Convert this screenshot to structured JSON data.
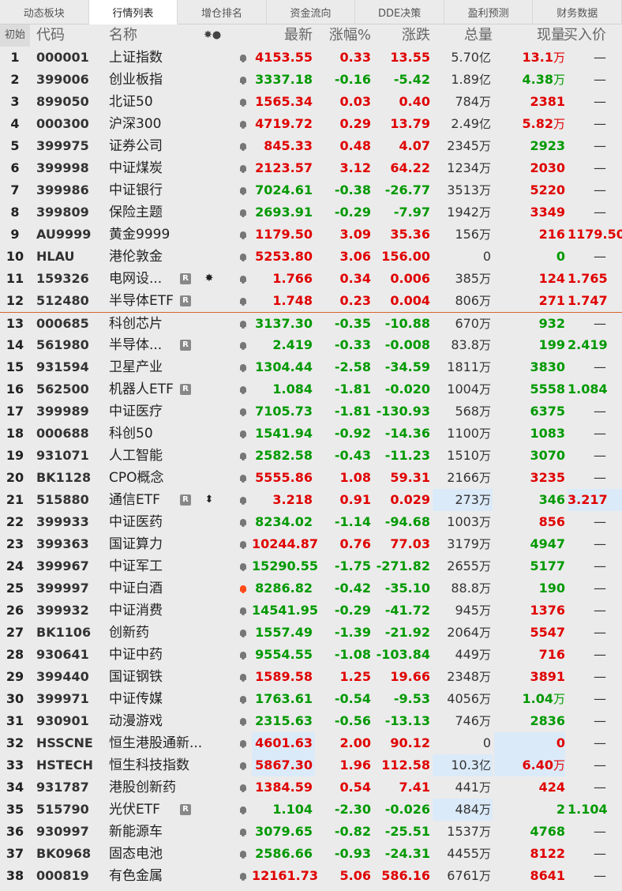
{
  "tabs": [
    "动态板块",
    "行情列表",
    "增仓排名",
    "资金流向",
    "DDE决策",
    "盈利预测",
    "财务数据"
  ],
  "active_tab": 1,
  "header": {
    "initial": "初始",
    "code": "代码",
    "name": "名称",
    "icons": "✸●",
    "last": "最新",
    "pct": "涨幅%",
    "change": "涨跌",
    "volume": "总量",
    "current": "现量",
    "bid": "买入价"
  },
  "colors": {
    "up": "#e00000",
    "down": "#009900",
    "highlight": "#dbeaf8",
    "separator": "#d9632c",
    "alert": "#ff4a1a"
  },
  "rows": [
    {
      "idx": "1",
      "code": "000001",
      "name": "上证指数",
      "badge": "",
      "star": "",
      "bell": "normal",
      "last": "4153.55",
      "pct": "0.33",
      "chg": "13.55",
      "vol": "5.70",
      "vol_unit": "亿",
      "cur": "13.1",
      "cur_unit": "万",
      "bid": "—",
      "dir": "up",
      "cur_color": "up",
      "bid_color": "dash"
    },
    {
      "idx": "2",
      "code": "399006",
      "name": "创业板指",
      "badge": "",
      "star": "",
      "bell": "normal",
      "last": "3337.18",
      "pct": "-0.16",
      "chg": "-5.42",
      "vol": "1.89",
      "vol_unit": "亿",
      "cur": "4.38",
      "cur_unit": "万",
      "bid": "—",
      "dir": "down",
      "cur_color": "down",
      "bid_color": "dash"
    },
    {
      "idx": "3",
      "code": "899050",
      "name": "北证50",
      "badge": "",
      "star": "",
      "bell": "normal",
      "last": "1565.34",
      "pct": "0.03",
      "chg": "0.40",
      "vol": "784",
      "vol_unit": "万",
      "cur": "2381",
      "cur_unit": "",
      "bid": "—",
      "dir": "up",
      "cur_color": "up",
      "bid_color": "dash"
    },
    {
      "idx": "4",
      "code": "000300",
      "name": "沪深300",
      "badge": "",
      "star": "",
      "bell": "normal",
      "last": "4719.72",
      "pct": "0.29",
      "chg": "13.79",
      "vol": "2.49",
      "vol_unit": "亿",
      "cur": "5.82",
      "cur_unit": "万",
      "bid": "—",
      "dir": "up",
      "cur_color": "up",
      "bid_color": "dash"
    },
    {
      "idx": "5",
      "code": "399975",
      "name": "证券公司",
      "badge": "",
      "star": "",
      "bell": "normal",
      "last": "845.33",
      "pct": "0.48",
      "chg": "4.07",
      "vol": "2345",
      "vol_unit": "万",
      "cur": "2923",
      "cur_unit": "",
      "bid": "—",
      "dir": "up",
      "cur_color": "down",
      "bid_color": "dash"
    },
    {
      "idx": "6",
      "code": "399998",
      "name": "中证煤炭",
      "badge": "",
      "star": "",
      "bell": "normal",
      "last": "2123.57",
      "pct": "3.12",
      "chg": "64.22",
      "vol": "1234",
      "vol_unit": "万",
      "cur": "2030",
      "cur_unit": "",
      "bid": "—",
      "dir": "up",
      "cur_color": "up",
      "bid_color": "dash"
    },
    {
      "idx": "7",
      "code": "399986",
      "name": "中证银行",
      "badge": "",
      "star": "",
      "bell": "normal",
      "last": "7024.61",
      "pct": "-0.38",
      "chg": "-26.77",
      "vol": "3513",
      "vol_unit": "万",
      "cur": "5220",
      "cur_unit": "",
      "bid": "—",
      "dir": "down",
      "cur_color": "up",
      "bid_color": "dash"
    },
    {
      "idx": "8",
      "code": "399809",
      "name": "保险主题",
      "badge": "",
      "star": "",
      "bell": "normal",
      "last": "2693.91",
      "pct": "-0.29",
      "chg": "-7.97",
      "vol": "1942",
      "vol_unit": "万",
      "cur": "3349",
      "cur_unit": "",
      "bid": "—",
      "dir": "down",
      "cur_color": "up",
      "bid_color": "dash"
    },
    {
      "idx": "9",
      "code": "AU9999",
      "name": "黄金9999",
      "badge": "",
      "star": "",
      "bell": "normal",
      "last": "1179.50",
      "pct": "3.09",
      "chg": "35.36",
      "vol": "156",
      "vol_unit": "万",
      "cur": "216",
      "cur_unit": "",
      "bid": "1179.50",
      "dir": "up",
      "cur_color": "up",
      "bid_color": "up"
    },
    {
      "idx": "10",
      "code": "HLAU",
      "name": "港伦敦金",
      "badge": "",
      "star": "",
      "bell": "normal",
      "last": "5253.80",
      "pct": "3.06",
      "chg": "156.00",
      "vol": "0",
      "vol_unit": "",
      "cur": "0",
      "cur_unit": "",
      "bid": "—",
      "dir": "up",
      "cur_color": "down",
      "bid_color": "dash"
    },
    {
      "idx": "11",
      "code": "159326",
      "name": "电网设...",
      "badge": "R",
      "star": "✸",
      "bell": "normal",
      "last": "1.766",
      "pct": "0.34",
      "chg": "0.006",
      "vol": "385",
      "vol_unit": "万",
      "cur": "124",
      "cur_unit": "",
      "bid": "1.765",
      "dir": "up",
      "cur_color": "up",
      "bid_color": "up"
    },
    {
      "idx": "12",
      "code": "512480",
      "name": "半导体ETF",
      "badge": "R",
      "star": "",
      "bell": "normal",
      "last": "1.748",
      "pct": "0.23",
      "chg": "0.004",
      "vol": "806",
      "vol_unit": "万",
      "cur": "271",
      "cur_unit": "",
      "bid": "1.747",
      "dir": "up",
      "cur_color": "up",
      "bid_color": "up"
    },
    {
      "idx": "13",
      "code": "000685",
      "name": "科创芯片",
      "badge": "",
      "star": "",
      "bell": "normal",
      "last": "3137.30",
      "pct": "-0.35",
      "chg": "-10.88",
      "vol": "670",
      "vol_unit": "万",
      "cur": "932",
      "cur_unit": "",
      "bid": "—",
      "dir": "down",
      "cur_color": "down",
      "bid_color": "dash"
    },
    {
      "idx": "14",
      "code": "561980",
      "name": "半导体...",
      "badge": "R",
      "star": "",
      "bell": "normal",
      "last": "2.419",
      "pct": "-0.33",
      "chg": "-0.008",
      "vol": "83.8",
      "vol_unit": "万",
      "cur": "199",
      "cur_unit": "",
      "bid": "2.419",
      "dir": "down",
      "cur_color": "down",
      "bid_color": "down"
    },
    {
      "idx": "15",
      "code": "931594",
      "name": "卫星产业",
      "badge": "",
      "star": "",
      "bell": "normal",
      "last": "1304.44",
      "pct": "-2.58",
      "chg": "-34.59",
      "vol": "1811",
      "vol_unit": "万",
      "cur": "3830",
      "cur_unit": "",
      "bid": "—",
      "dir": "down",
      "cur_color": "down",
      "bid_color": "dash"
    },
    {
      "idx": "16",
      "code": "562500",
      "name": "机器人ETF",
      "badge": "R",
      "star": "",
      "bell": "normal",
      "last": "1.084",
      "pct": "-1.81",
      "chg": "-0.020",
      "vol": "1004",
      "vol_unit": "万",
      "cur": "5558",
      "cur_unit": "",
      "bid": "1.084",
      "dir": "down",
      "cur_color": "down",
      "bid_color": "down"
    },
    {
      "idx": "17",
      "code": "399989",
      "name": "中证医疗",
      "badge": "",
      "star": "",
      "bell": "normal",
      "last": "7105.73",
      "pct": "-1.81",
      "chg": "-130.93",
      "vol": "568",
      "vol_unit": "万",
      "cur": "6375",
      "cur_unit": "",
      "bid": "—",
      "dir": "down",
      "cur_color": "down",
      "bid_color": "dash"
    },
    {
      "idx": "18",
      "code": "000688",
      "name": "科创50",
      "badge": "",
      "star": "",
      "bell": "normal",
      "last": "1541.94",
      "pct": "-0.92",
      "chg": "-14.36",
      "vol": "1100",
      "vol_unit": "万",
      "cur": "1083",
      "cur_unit": "",
      "bid": "—",
      "dir": "down",
      "cur_color": "down",
      "bid_color": "dash"
    },
    {
      "idx": "19",
      "code": "931071",
      "name": "人工智能",
      "badge": "",
      "star": "",
      "bell": "normal",
      "last": "2582.58",
      "pct": "-0.43",
      "chg": "-11.23",
      "vol": "1510",
      "vol_unit": "万",
      "cur": "3070",
      "cur_unit": "",
      "bid": "—",
      "dir": "down",
      "cur_color": "down",
      "bid_color": "dash"
    },
    {
      "idx": "20",
      "code": "BK1128",
      "name": "CPO概念",
      "badge": "",
      "star": "",
      "bell": "normal",
      "last": "5555.86",
      "pct": "1.08",
      "chg": "59.31",
      "vol": "2166",
      "vol_unit": "万",
      "cur": "3235",
      "cur_unit": "",
      "bid": "—",
      "dir": "up",
      "cur_color": "up",
      "bid_color": "dash"
    },
    {
      "idx": "21",
      "code": "515880",
      "name": "通信ETF",
      "badge": "R",
      "star": "⬍",
      "bell": "normal",
      "last": "3.218",
      "pct": "0.91",
      "chg": "0.029",
      "vol": "273",
      "vol_unit": "万",
      "cur": "346",
      "cur_unit": "",
      "bid": "3.217",
      "dir": "up",
      "cur_color": "down",
      "bid_color": "up",
      "hl_vol": true,
      "hl_bid": true
    },
    {
      "idx": "22",
      "code": "399933",
      "name": "中证医药",
      "badge": "",
      "star": "",
      "bell": "normal",
      "last": "8234.02",
      "pct": "-1.14",
      "chg": "-94.68",
      "vol": "1003",
      "vol_unit": "万",
      "cur": "856",
      "cur_unit": "",
      "bid": "—",
      "dir": "down",
      "cur_color": "up",
      "bid_color": "dash"
    },
    {
      "idx": "23",
      "code": "399363",
      "name": "国证算力",
      "badge": "",
      "star": "",
      "bell": "normal",
      "last": "10244.87",
      "pct": "0.76",
      "chg": "77.03",
      "vol": "3179",
      "vol_unit": "万",
      "cur": "4947",
      "cur_unit": "",
      "bid": "—",
      "dir": "up",
      "cur_color": "down",
      "bid_color": "dash"
    },
    {
      "idx": "24",
      "code": "399967",
      "name": "中证军工",
      "badge": "",
      "star": "",
      "bell": "normal",
      "last": "15290.55",
      "pct": "-1.75",
      "chg": "-271.82",
      "vol": "2655",
      "vol_unit": "万",
      "cur": "5177",
      "cur_unit": "",
      "bid": "—",
      "dir": "down",
      "cur_color": "down",
      "bid_color": "dash"
    },
    {
      "idx": "25",
      "code": "399997",
      "name": "中证白酒",
      "badge": "",
      "star": "",
      "bell": "hot",
      "last": "8286.82",
      "pct": "-0.42",
      "chg": "-35.10",
      "vol": "88.8",
      "vol_unit": "万",
      "cur": "190",
      "cur_unit": "",
      "bid": "—",
      "dir": "down",
      "cur_color": "down",
      "bid_color": "dash"
    },
    {
      "idx": "26",
      "code": "399932",
      "name": "中证消费",
      "badge": "",
      "star": "",
      "bell": "normal",
      "last": "14541.95",
      "pct": "-0.29",
      "chg": "-41.72",
      "vol": "945",
      "vol_unit": "万",
      "cur": "1376",
      "cur_unit": "",
      "bid": "—",
      "dir": "down",
      "cur_color": "up",
      "bid_color": "dash"
    },
    {
      "idx": "27",
      "code": "BK1106",
      "name": "创新药",
      "badge": "",
      "star": "",
      "bell": "normal",
      "last": "1557.49",
      "pct": "-1.39",
      "chg": "-21.92",
      "vol": "2064",
      "vol_unit": "万",
      "cur": "5547",
      "cur_unit": "",
      "bid": "—",
      "dir": "down",
      "cur_color": "up",
      "bid_color": "dash"
    },
    {
      "idx": "28",
      "code": "930641",
      "name": "中证中药",
      "badge": "",
      "star": "",
      "bell": "normal",
      "last": "9554.55",
      "pct": "-1.08",
      "chg": "-103.84",
      "vol": "449",
      "vol_unit": "万",
      "cur": "716",
      "cur_unit": "",
      "bid": "—",
      "dir": "down",
      "cur_color": "up",
      "bid_color": "dash"
    },
    {
      "idx": "29",
      "code": "399440",
      "name": "国证钢铁",
      "badge": "",
      "star": "",
      "bell": "normal",
      "last": "1589.58",
      "pct": "1.25",
      "chg": "19.66",
      "vol": "2348",
      "vol_unit": "万",
      "cur": "3891",
      "cur_unit": "",
      "bid": "—",
      "dir": "up",
      "cur_color": "up",
      "bid_color": "dash"
    },
    {
      "idx": "30",
      "code": "399971",
      "name": "中证传媒",
      "badge": "",
      "star": "",
      "bell": "normal",
      "last": "1763.61",
      "pct": "-0.54",
      "chg": "-9.53",
      "vol": "4056",
      "vol_unit": "万",
      "cur": "1.04",
      "cur_unit": "万",
      "bid": "—",
      "dir": "down",
      "cur_color": "down",
      "bid_color": "dash"
    },
    {
      "idx": "31",
      "code": "930901",
      "name": "动漫游戏",
      "badge": "",
      "star": "",
      "bell": "normal",
      "last": "2315.63",
      "pct": "-0.56",
      "chg": "-13.13",
      "vol": "746",
      "vol_unit": "万",
      "cur": "2836",
      "cur_unit": "",
      "bid": "—",
      "dir": "down",
      "cur_color": "down",
      "bid_color": "dash"
    },
    {
      "idx": "32",
      "code": "HSSCNE",
      "name": "恒生港股通新...",
      "badge": "",
      "star": "",
      "bell": "normal",
      "last": "4601.63",
      "pct": "2.00",
      "chg": "90.12",
      "vol": "0",
      "vol_unit": "",
      "cur": "0",
      "cur_unit": "",
      "bid": "—",
      "dir": "up",
      "cur_color": "up",
      "bid_color": "dash",
      "hl_last": true,
      "hl_cur": true
    },
    {
      "idx": "33",
      "code": "HSTECH",
      "name": "恒生科技指数",
      "badge": "",
      "star": "",
      "bell": "normal",
      "last": "5867.30",
      "pct": "1.96",
      "chg": "112.58",
      "vol": "10.3",
      "vol_unit": "亿",
      "cur": "6.40",
      "cur_unit": "万",
      "bid": "—",
      "dir": "up",
      "cur_color": "up",
      "bid_color": "dash",
      "hl_last": true,
      "hl_vol": true,
      "hl_cur": true
    },
    {
      "idx": "34",
      "code": "931787",
      "name": "港股创新药",
      "badge": "",
      "star": "",
      "bell": "normal",
      "last": "1384.59",
      "pct": "0.54",
      "chg": "7.41",
      "vol": "441",
      "vol_unit": "万",
      "cur": "424",
      "cur_unit": "",
      "bid": "—",
      "dir": "up",
      "cur_color": "up",
      "bid_color": "dash"
    },
    {
      "idx": "35",
      "code": "515790",
      "name": "光伏ETF",
      "badge": "R",
      "star": "",
      "bell": "normal",
      "last": "1.104",
      "pct": "-2.30",
      "chg": "-0.026",
      "vol": "484",
      "vol_unit": "万",
      "cur": "2",
      "cur_unit": "",
      "bid": "1.104",
      "dir": "down",
      "cur_color": "down",
      "bid_color": "down",
      "hl_vol": true
    },
    {
      "idx": "36",
      "code": "930997",
      "name": "新能源车",
      "badge": "",
      "star": "",
      "bell": "normal",
      "last": "3079.65",
      "pct": "-0.82",
      "chg": "-25.51",
      "vol": "1537",
      "vol_unit": "万",
      "cur": "4768",
      "cur_unit": "",
      "bid": "—",
      "dir": "down",
      "cur_color": "down",
      "bid_color": "dash"
    },
    {
      "idx": "37",
      "code": "BK0968",
      "name": "固态电池",
      "badge": "",
      "star": "",
      "bell": "normal",
      "last": "2586.66",
      "pct": "-0.93",
      "chg": "-24.31",
      "vol": "4455",
      "vol_unit": "万",
      "cur": "8122",
      "cur_unit": "",
      "bid": "—",
      "dir": "down",
      "cur_color": "up",
      "bid_color": "dash"
    },
    {
      "idx": "38",
      "code": "000819",
      "name": "有色金属",
      "badge": "",
      "star": "",
      "bell": "normal",
      "last": "12161.73",
      "pct": "5.06",
      "chg": "586.16",
      "vol": "6761",
      "vol_unit": "万",
      "cur": "8641",
      "cur_unit": "",
      "bid": "—",
      "dir": "up",
      "cur_color": "up",
      "bid_color": "dash"
    }
  ]
}
